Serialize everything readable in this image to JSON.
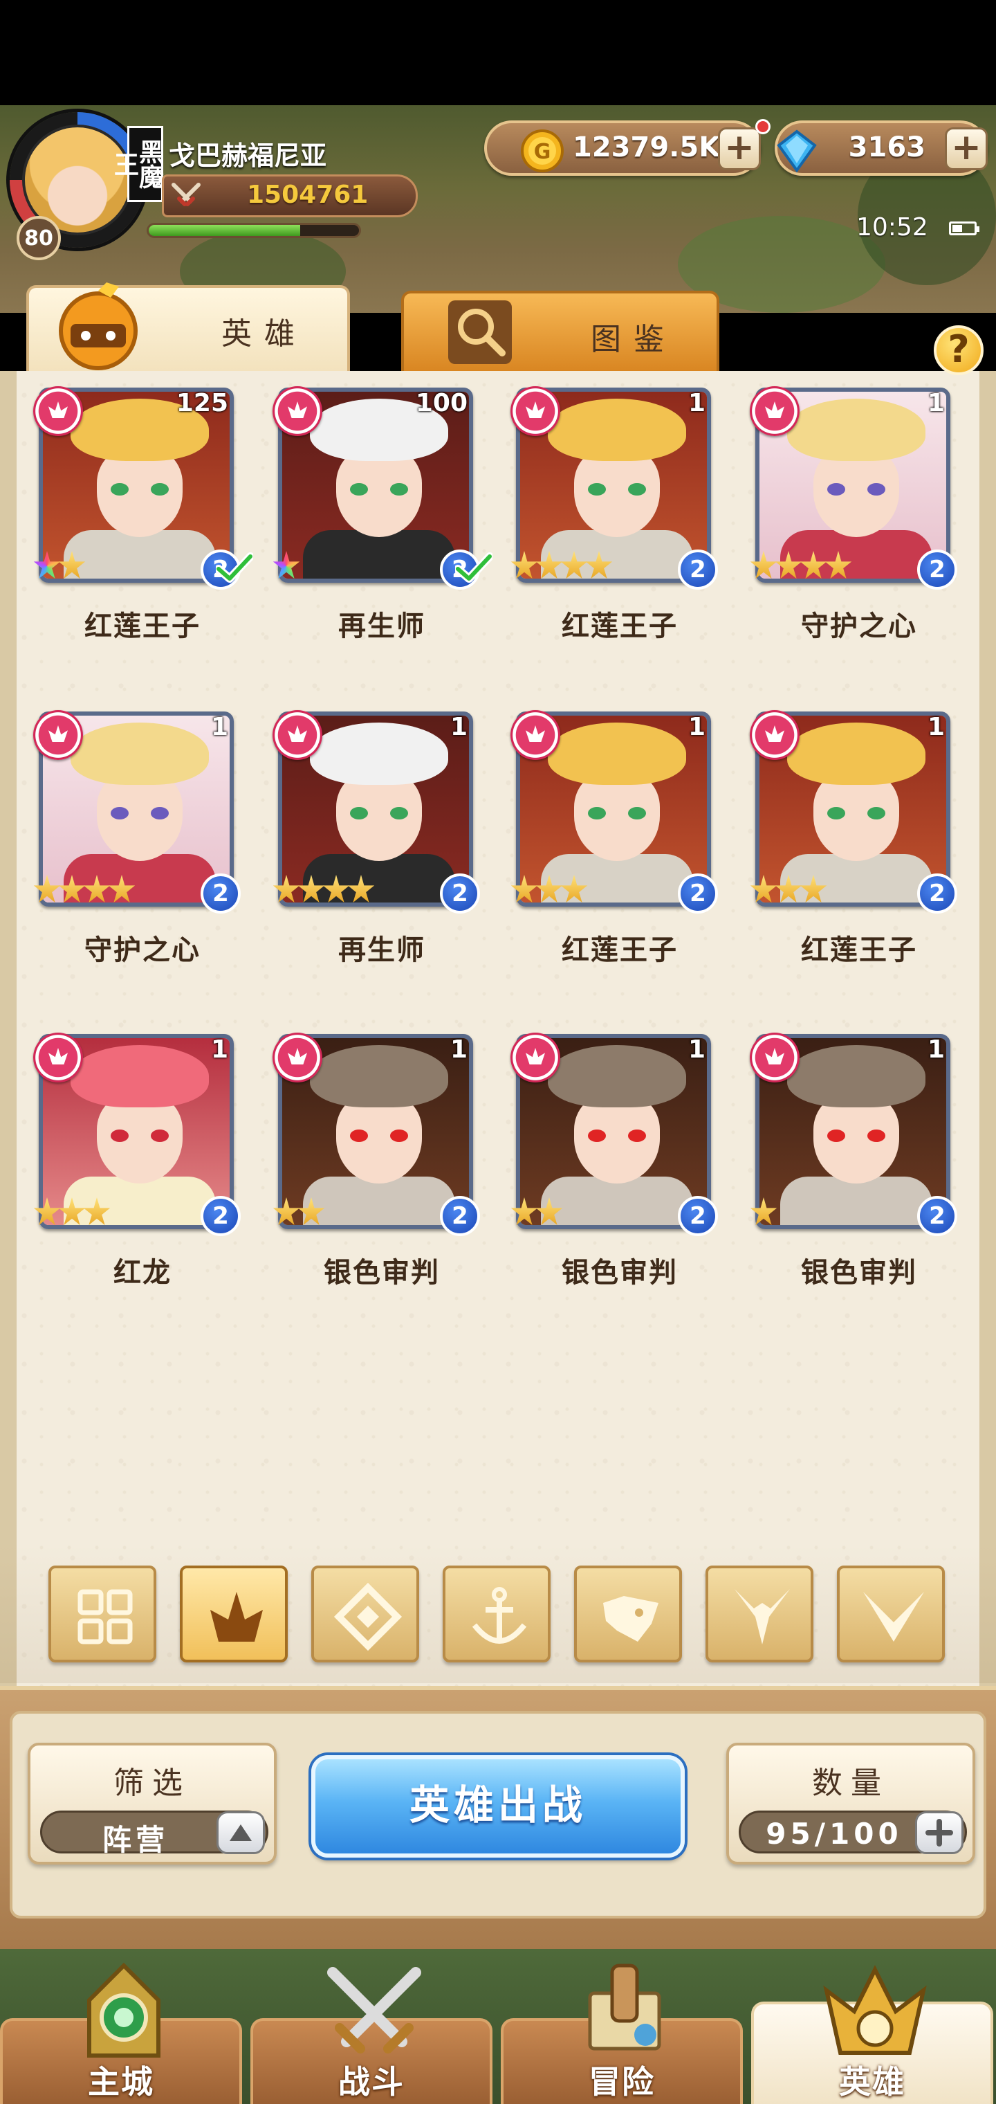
{
  "header": {
    "player_name": "戈巴赫福尼亚",
    "avatar_tag": "黑魔王",
    "level": "80",
    "power": "1504761",
    "exp_progress": 0.72,
    "coins": "12379.5K",
    "gems": "3163",
    "clock": "10:52"
  },
  "tabs": {
    "heroes": "英雄",
    "atlas": "图鉴"
  },
  "help": "?",
  "heroes": [
    {
      "name": "红莲王子",
      "level": "125",
      "stars": 2,
      "rainbow": 1,
      "class": "2",
      "check": true,
      "look": "blond"
    },
    {
      "name": "再生师",
      "level": "100",
      "stars": 1,
      "rainbow": 1,
      "class": "2",
      "check": true,
      "look": "white"
    },
    {
      "name": "红莲王子",
      "level": "1",
      "stars": 4,
      "rainbow": 0,
      "class": "2",
      "check": false,
      "look": "blond"
    },
    {
      "name": "守护之心",
      "level": "1",
      "stars": 4,
      "rainbow": 0,
      "class": "2",
      "check": false,
      "look": "guardian"
    },
    {
      "name": "守护之心",
      "level": "1",
      "stars": 4,
      "rainbow": 0,
      "class": "2",
      "check": false,
      "look": "guardian"
    },
    {
      "name": "再生师",
      "level": "1",
      "stars": 4,
      "rainbow": 0,
      "class": "2",
      "check": false,
      "look": "white"
    },
    {
      "name": "红莲王子",
      "level": "1",
      "stars": 3,
      "rainbow": 0,
      "class": "2",
      "check": false,
      "look": "blond"
    },
    {
      "name": "红莲王子",
      "level": "1",
      "stars": 3,
      "rainbow": 0,
      "class": "2",
      "check": false,
      "look": "blond"
    },
    {
      "name": "红龙",
      "level": "1",
      "stars": 3,
      "rainbow": 0,
      "class": "2",
      "check": false,
      "look": "dragon"
    },
    {
      "name": "银色审判",
      "level": "1",
      "stars": 2,
      "rainbow": 0,
      "class": "2",
      "check": false,
      "look": "knight"
    },
    {
      "name": "银色审判",
      "level": "1",
      "stars": 2,
      "rainbow": 0,
      "class": "2",
      "check": false,
      "look": "knight"
    },
    {
      "name": "银色审判",
      "level": "1",
      "stars": 1,
      "rainbow": 0,
      "class": "2",
      "check": false,
      "look": "knight"
    }
  ],
  "filters": [
    "all-grid-icon",
    "fire-faction-icon",
    "earth-faction-icon",
    "anchor-icon",
    "beast-head-icon",
    "demon-horn-icon",
    "wing-icon"
  ],
  "filter_active": 1,
  "filter_box": {
    "title": "筛选",
    "value": "阵营"
  },
  "deploy_button": "英雄出战",
  "count_box": {
    "title": "数量",
    "value": "95/100"
  },
  "nav": {
    "main_city": "主城",
    "battle": "战斗",
    "adventure": "冒险",
    "heroes": "英雄"
  },
  "colors": {
    "accent_blue": "#2f88e0",
    "faction_pink": "#e23a6a",
    "parchment": "#f3ecdd",
    "gold": "#f5c93d"
  }
}
